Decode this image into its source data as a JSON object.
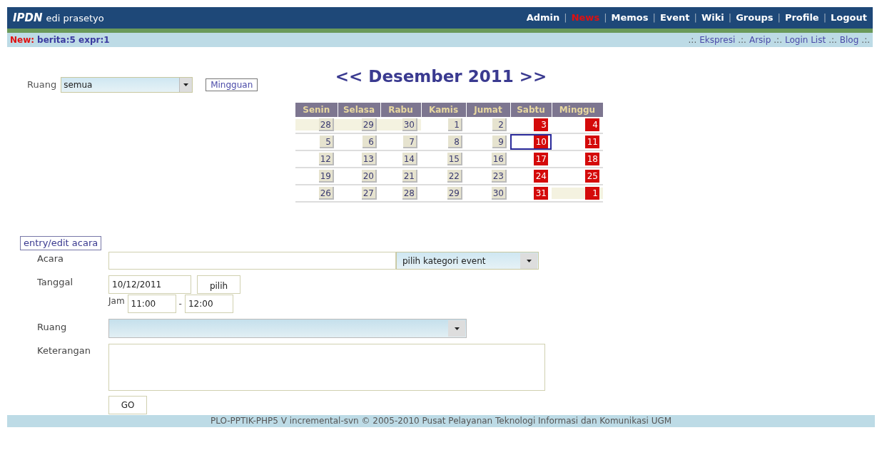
{
  "header": {
    "brand": "IPDN",
    "user": "edi prasetyo",
    "separator": "|",
    "nav": [
      {
        "label": "Admin",
        "selected": false
      },
      {
        "label": "News",
        "selected": true
      },
      {
        "label": "Memos",
        "selected": false
      },
      {
        "label": "Event",
        "selected": false
      },
      {
        "label": "Wiki",
        "selected": false
      },
      {
        "label": "Groups",
        "selected": false
      },
      {
        "label": "Profile",
        "selected": false
      },
      {
        "label": "Logout",
        "selected": false
      }
    ]
  },
  "subbar": {
    "new_label": "New:",
    "new_items": "berita:5 expr:1",
    "separator": ".:.",
    "links": [
      "Ekspresi",
      "Arsip",
      "Login List",
      "Blog"
    ]
  },
  "calendar": {
    "prev": "<<",
    "title": "Desember 2011",
    "next": ">>",
    "filter": {
      "label": "Ruang",
      "value": "semua",
      "button": "Mingguan"
    },
    "weekdays": [
      "Senin",
      "Selasa",
      "Rabu",
      "Kamis",
      "Jumat",
      "Sabtu",
      "Minggu"
    ],
    "weeks": [
      [
        {
          "day": "28",
          "other_month": true,
          "holiday": false,
          "selected": false
        },
        {
          "day": "29",
          "other_month": true,
          "holiday": false,
          "selected": false
        },
        {
          "day": "30",
          "other_month": true,
          "holiday": false,
          "selected": false
        },
        {
          "day": "1",
          "other_month": false,
          "holiday": false,
          "selected": false
        },
        {
          "day": "2",
          "other_month": false,
          "holiday": false,
          "selected": false
        },
        {
          "day": "3",
          "other_month": false,
          "holiday": true,
          "selected": false
        },
        {
          "day": "4",
          "other_month": false,
          "holiday": true,
          "selected": false
        }
      ],
      [
        {
          "day": "5",
          "other_month": false,
          "holiday": false,
          "selected": false
        },
        {
          "day": "6",
          "other_month": false,
          "holiday": false,
          "selected": false
        },
        {
          "day": "7",
          "other_month": false,
          "holiday": false,
          "selected": false
        },
        {
          "day": "8",
          "other_month": false,
          "holiday": false,
          "selected": false
        },
        {
          "day": "9",
          "other_month": false,
          "holiday": false,
          "selected": false
        },
        {
          "day": "10",
          "other_month": false,
          "holiday": true,
          "selected": true
        },
        {
          "day": "11",
          "other_month": false,
          "holiday": true,
          "selected": false
        }
      ],
      [
        {
          "day": "12",
          "other_month": false,
          "holiday": false,
          "selected": false
        },
        {
          "day": "13",
          "other_month": false,
          "holiday": false,
          "selected": false
        },
        {
          "day": "14",
          "other_month": false,
          "holiday": false,
          "selected": false
        },
        {
          "day": "15",
          "other_month": false,
          "holiday": false,
          "selected": false
        },
        {
          "day": "16",
          "other_month": false,
          "holiday": false,
          "selected": false
        },
        {
          "day": "17",
          "other_month": false,
          "holiday": true,
          "selected": false
        },
        {
          "day": "18",
          "other_month": false,
          "holiday": true,
          "selected": false
        }
      ],
      [
        {
          "day": "19",
          "other_month": false,
          "holiday": false,
          "selected": false
        },
        {
          "day": "20",
          "other_month": false,
          "holiday": false,
          "selected": false
        },
        {
          "day": "21",
          "other_month": false,
          "holiday": false,
          "selected": false
        },
        {
          "day": "22",
          "other_month": false,
          "holiday": false,
          "selected": false
        },
        {
          "day": "23",
          "other_month": false,
          "holiday": false,
          "selected": false
        },
        {
          "day": "24",
          "other_month": false,
          "holiday": true,
          "selected": false
        },
        {
          "day": "25",
          "other_month": false,
          "holiday": true,
          "selected": false
        }
      ],
      [
        {
          "day": "26",
          "other_month": false,
          "holiday": false,
          "selected": false
        },
        {
          "day": "27",
          "other_month": false,
          "holiday": false,
          "selected": false
        },
        {
          "day": "28",
          "other_month": false,
          "holiday": false,
          "selected": false
        },
        {
          "day": "29",
          "other_month": false,
          "holiday": false,
          "selected": false
        },
        {
          "day": "30",
          "other_month": false,
          "holiday": false,
          "selected": false
        },
        {
          "day": "31",
          "other_month": false,
          "holiday": true,
          "selected": false
        },
        {
          "day": "1",
          "other_month": true,
          "holiday": true,
          "selected": false
        }
      ]
    ]
  },
  "form": {
    "legend": "entry/edit acara",
    "acara": {
      "label": "Acara",
      "category": "pilih kategori event"
    },
    "tanggal": {
      "label": "Tanggal",
      "value": "10/12/2011",
      "pick": "pilih",
      "jam_label": "Jam",
      "start": "11:00",
      "dash": "-",
      "end": "12:00"
    },
    "ruang": {
      "label": "Ruang"
    },
    "keterangan": {
      "label": "Keterangan"
    },
    "submit": "GO"
  },
  "footer": "PLO-PPTIK-PHP5 V incremental-svn © 2005-2010 Pusat Pelayanan Teknologi Informasi dan Komunikasi UGM"
}
